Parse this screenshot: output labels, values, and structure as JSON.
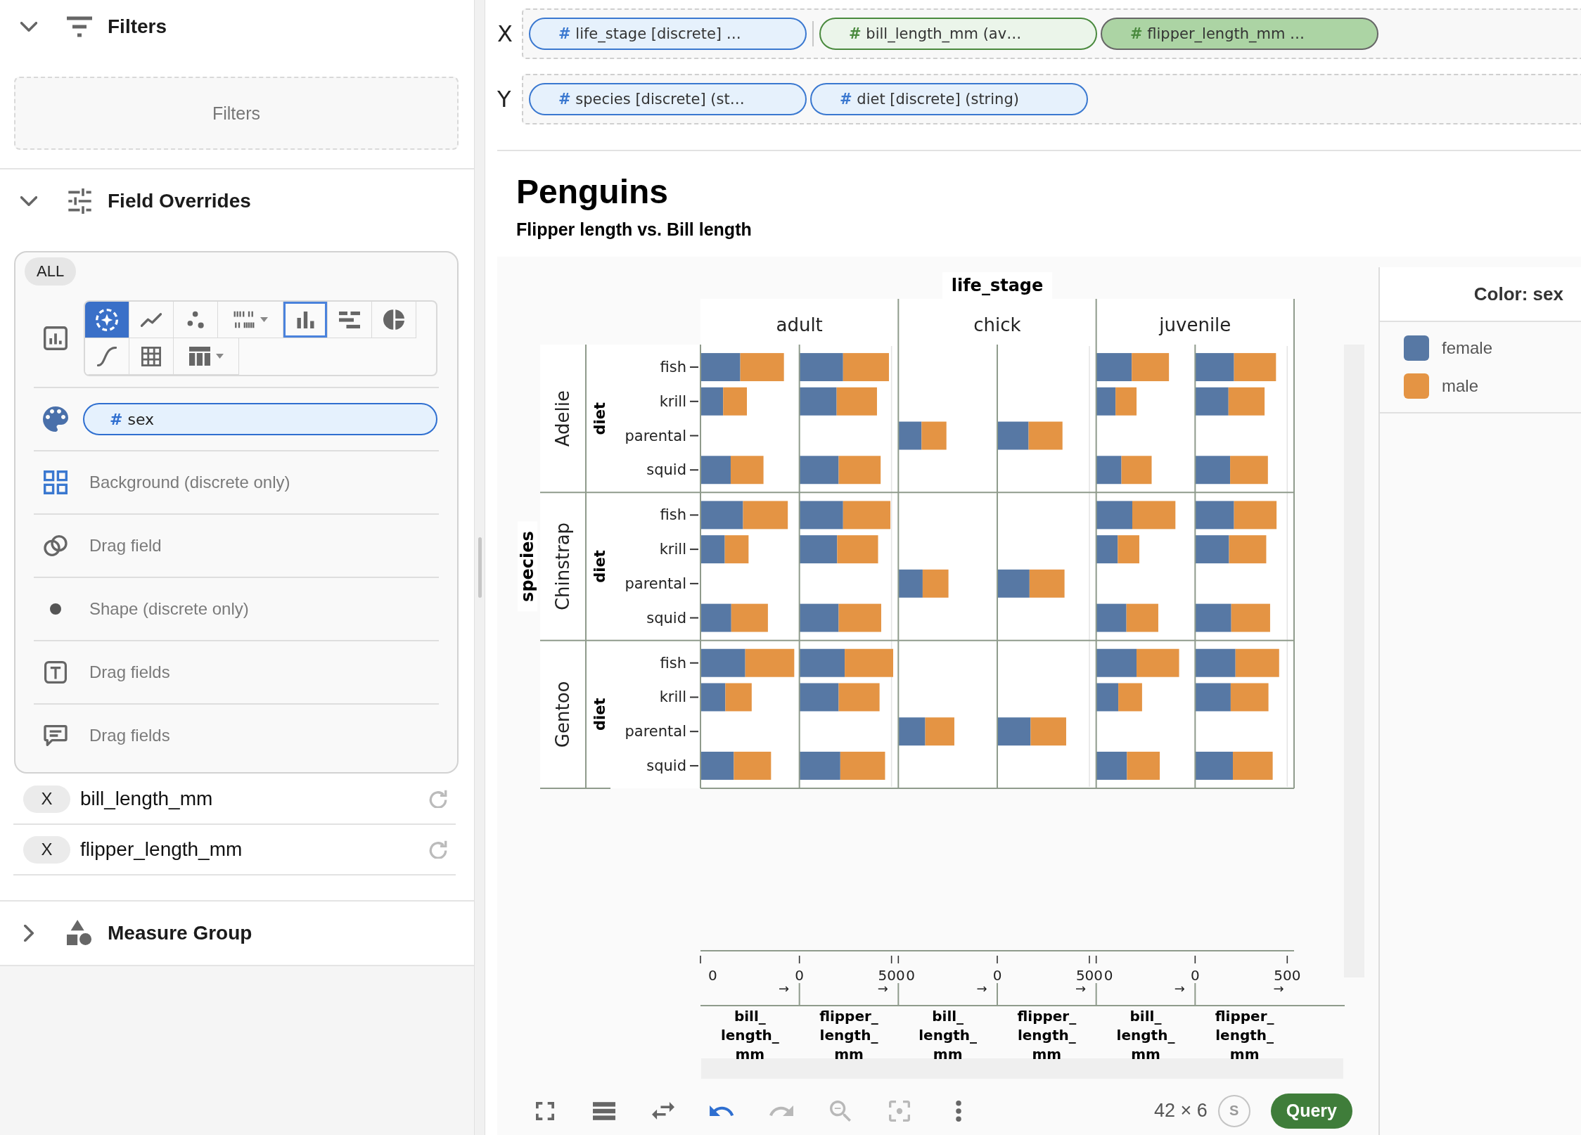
{
  "sidebar": {
    "filters": {
      "title": "Filters",
      "expanded": true,
      "dropzone": {
        "placeholder": "Filters"
      }
    },
    "field_overrides": {
      "title": "Field Overrides",
      "expanded": true,
      "scope": "ALL",
      "mark_types": [
        {
          "kind": "auto",
          "active": true,
          "selected": false,
          "dropdown": false
        },
        {
          "kind": "line",
          "active": false,
          "selected": false,
          "dropdown": false
        },
        {
          "kind": "point",
          "active": false,
          "selected": false,
          "dropdown": false
        },
        {
          "kind": "tick",
          "active": false,
          "selected": false,
          "dropdown": true
        },
        {
          "kind": "bar",
          "active": false,
          "selected": true,
          "dropdown": false
        },
        {
          "kind": "rule",
          "active": false,
          "selected": false,
          "dropdown": false
        },
        {
          "kind": "arc",
          "active": false,
          "selected": false,
          "dropdown": false
        },
        {
          "kind": "curve",
          "active": false,
          "selected": false,
          "dropdown": false
        },
        {
          "kind": "grid",
          "active": false,
          "selected": false,
          "dropdown": false
        },
        {
          "kind": "table",
          "active": false,
          "selected": false,
          "dropdown": true
        }
      ],
      "encodings": [
        {
          "kind": "color",
          "field": {
            "symbol": "#",
            "name": "sex"
          }
        },
        {
          "kind": "background",
          "placeholder": "Background (discrete only)"
        },
        {
          "kind": "opacity",
          "placeholder": "Drag field"
        },
        {
          "kind": "shape",
          "placeholder": "Shape (discrete only)"
        },
        {
          "kind": "text",
          "placeholder": "Drag fields"
        },
        {
          "kind": "details",
          "placeholder": "Drag fields"
        }
      ],
      "overrides": [
        {
          "channel": "X",
          "field": "bill_length_mm"
        },
        {
          "channel": "X",
          "field": "flipper_length_mm"
        }
      ]
    },
    "measure_group": {
      "title": "Measure Group",
      "expanded": false
    }
  },
  "shelves": [
    {
      "axis": "X",
      "pills": [
        {
          "symbol": "#",
          "label": "life_stage [discrete] …",
          "kind": "dimension",
          "selected": false
        },
        {
          "symbol": "#",
          "label": "bill_length_mm (av…",
          "kind": "measure",
          "selected": false
        },
        {
          "symbol": "#",
          "label": "flipper_length_mm …",
          "kind": "measure",
          "selected": true
        }
      ]
    },
    {
      "axis": "Y",
      "pills": [
        {
          "symbol": "#",
          "label": "species [discrete] (st…",
          "kind": "dimension",
          "selected": false
        },
        {
          "symbol": "#",
          "label": "diet [discrete] (string)",
          "kind": "dimension",
          "selected": false
        }
      ]
    }
  ],
  "chart": {
    "title": "Penguins",
    "subtitle": "Flipper length vs. Bill length",
    "column_field": "life_stage",
    "columns": [
      "adult",
      "chick",
      "juvenile"
    ],
    "row_field": "species",
    "rows": [
      {
        "label": "Adelie",
        "axis_title": "diet",
        "categories": [
          "fish",
          "krill",
          "parental",
          "squid"
        ]
      },
      {
        "label": "Chinstrap",
        "axis_title": "diet",
        "categories": [
          "fish",
          "krill",
          "parental",
          "squid"
        ]
      },
      {
        "label": "Gentoo",
        "axis_title": "diet",
        "categories": [
          "fish",
          "krill",
          "parental",
          "squid"
        ]
      }
    ],
    "panels": [
      {
        "kind": "picture",
        "tick_labels": [
          "0"
        ],
        "end_mark": "→",
        "title": "bill_length_mm"
      },
      {
        "kind": "picture",
        "tick_labels": [
          "0",
          "500"
        ],
        "end_mark": "→",
        "title": "flipper_length_mm"
      },
      {
        "kind": "picture",
        "tick_labels": [
          "0"
        ],
        "end_mark": "→",
        "title": "bill_length_mm"
      },
      {
        "kind": "picture",
        "tick_labels": [
          "0",
          "500"
        ],
        "end_mark": "→",
        "title": "flipper_length_mm"
      },
      {
        "kind": "picture",
        "tick_labels": [
          "0"
        ],
        "end_mark": "→",
        "title": "bill_length_mm"
      },
      {
        "kind": "picture",
        "tick_labels": [
          "0",
          "500"
        ],
        "end_mark": "→",
        "title": "flipper_length_mm"
      }
    ],
    "legend": {
      "title": "Color: sex",
      "items": [
        {
          "label": "female",
          "color": "#5778a4"
        },
        {
          "label": "male",
          "color": "#e49444"
        }
      ]
    }
  },
  "toolbar": {
    "tools": [
      {
        "kind": "fullscreen",
        "accent": false,
        "disabled": false
      },
      {
        "kind": "list",
        "accent": false,
        "disabled": false
      },
      {
        "kind": "transpose",
        "accent": false,
        "disabled": false
      },
      {
        "kind": "undo",
        "accent": true,
        "disabled": false
      },
      {
        "kind": "redo",
        "accent": false,
        "disabled": true
      },
      {
        "kind": "zoom_out",
        "accent": false,
        "disabled": true
      },
      {
        "kind": "focus",
        "accent": false,
        "disabled": true
      },
      {
        "kind": "more",
        "accent": false,
        "disabled": false
      }
    ],
    "size": "42 × 6",
    "badge": "S",
    "query_button": "Query"
  }
}
